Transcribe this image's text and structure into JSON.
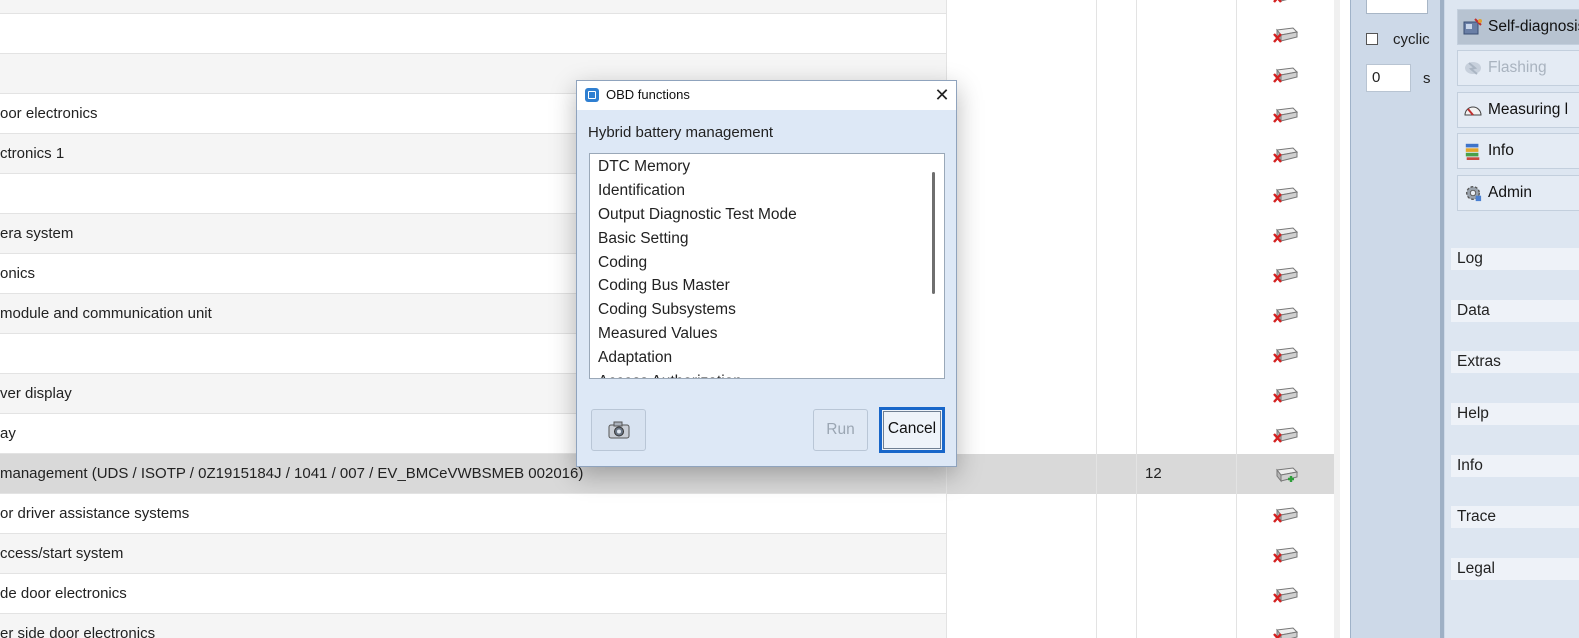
{
  "table": {
    "rows": [
      {
        "name": "",
        "col3": "",
        "status": "error"
      },
      {
        "name": "",
        "col3": "",
        "status": "error"
      },
      {
        "name": "",
        "col3": "",
        "status": "error"
      },
      {
        "name": "oor electronics",
        "col3": "",
        "status": "error"
      },
      {
        "name": "ctronics 1",
        "col3": "",
        "status": "error"
      },
      {
        "name": "",
        "col3": "",
        "status": "error"
      },
      {
        "name": "era system",
        "col3": "",
        "status": "error"
      },
      {
        "name": "onics",
        "col3": "",
        "status": "error"
      },
      {
        "name": " module and communication unit",
        "col3": "",
        "status": "error"
      },
      {
        "name": "",
        "col3": "",
        "status": "error"
      },
      {
        "name": "ver display",
        "col3": "",
        "status": "error"
      },
      {
        "name": "ay",
        "col3": "",
        "status": "error"
      },
      {
        "name": "management  (UDS / ISOTP / 0Z1915184J / 1041 / 007 / EV_BMCeVWBSMEB 002016)",
        "col3": "12",
        "status": "ok"
      },
      {
        "name": "or driver assistance systems",
        "col3": "",
        "status": "error"
      },
      {
        "name": "ccess/start system",
        "col3": "",
        "status": "error"
      },
      {
        "name": "de door electronics",
        "col3": "",
        "status": "error"
      },
      {
        "name": "er side door electronics",
        "col3": "",
        "status": "error"
      }
    ]
  },
  "sidepanel": {
    "cyclic_label": "cyclic",
    "interval_value": "0",
    "interval_unit": "s",
    "buttons": [
      {
        "label": "Self-diagnosis",
        "icon": "self-diagnosis-icon",
        "state": "active"
      },
      {
        "label": "Flashing",
        "icon": "flashing-icon",
        "state": "disabled"
      },
      {
        "label": "Measuring l",
        "icon": "measuring-icon",
        "state": "normal"
      },
      {
        "label": "Info",
        "icon": "info-books-icon",
        "state": "normal"
      },
      {
        "label": "Admin",
        "icon": "admin-gear-icon",
        "state": "normal"
      }
    ],
    "sections": [
      "Log",
      "Data",
      "Extras",
      "Help",
      "Info",
      "Trace",
      "Legal"
    ]
  },
  "dialog": {
    "title": "OBD functions",
    "close_glyph": "✕",
    "heading": "Hybrid battery management",
    "items": [
      "DTC Memory",
      "Identification",
      "Output Diagnostic Test Mode",
      "Basic Setting",
      "Coding",
      "Coding Bus Master",
      "Coding Subsystems",
      "Measured Values",
      "Adaptation",
      "Access Authorization"
    ],
    "run_label": "Run",
    "cancel_label": "Cancel"
  },
  "colors": {
    "dialog_bg": "#dde8f6",
    "focus_border": "#1866c9",
    "panel_bg": "#cdd9e8",
    "selected_row": "#d9d9d9"
  }
}
